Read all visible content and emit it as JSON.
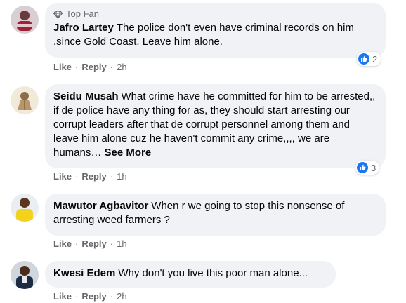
{
  "comments": [
    {
      "badge": "Top Fan",
      "author": "Jafro Lartey",
      "text": "The police don't even have criminal records on him ,since Gold Coast. Leave him alone.",
      "actions": {
        "like": "Like",
        "reply": "Reply",
        "time": "2h"
      },
      "reactions": "2"
    },
    {
      "author": "Seidu Musah",
      "text": "What crime have he committed for him to be arrested,, if de police have any thing for as, they should start arresting our corrupt leaders after that de corrupt personnel among them and leave him alone cuz he haven't commit any crime,,,, we are humans…",
      "see_more": "See More",
      "actions": {
        "like": "Like",
        "reply": "Reply",
        "time": "1h"
      },
      "reactions": "3"
    },
    {
      "author": "Mawutor Agbavitor",
      "text": "When r we going to stop this nonsense of arresting weed farmers ?",
      "actions": {
        "like": "Like",
        "reply": "Reply",
        "time": "1h"
      }
    },
    {
      "author": "Kwesi Edem",
      "text": "Why don't you live this poor man alone...",
      "actions": {
        "like": "Like",
        "reply": "Reply",
        "time": "2h"
      }
    }
  ],
  "colors": {
    "bubble": "#f0f2f5",
    "like_blue": "#1877f2",
    "meta_gray": "#65676b"
  }
}
